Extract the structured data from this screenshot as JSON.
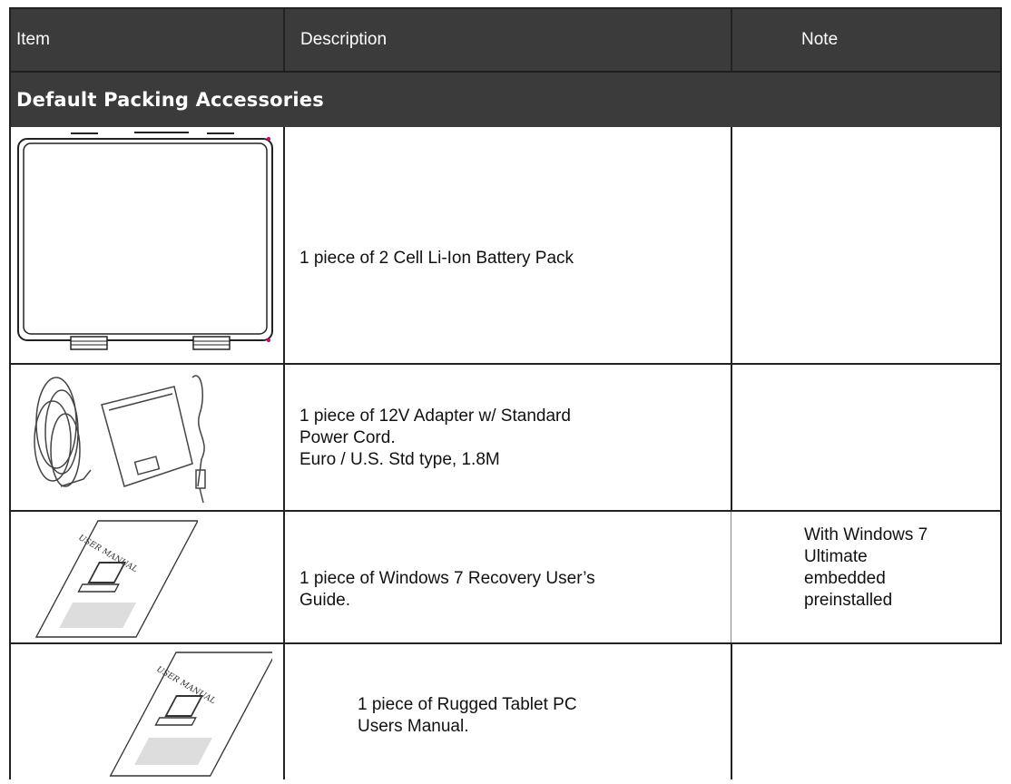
{
  "header": {
    "item": "Item",
    "description": "Description",
    "note": "Note"
  },
  "section": {
    "title": "Default Packing Accessories"
  },
  "rows": [
    {
      "description_lines": [
        "1 piece of 2 Cell Li-Ion Battery Pack"
      ],
      "note_lines": []
    },
    {
      "description_lines": [
        "1 piece of 12V Adapter w/ Standard",
        "Power Cord.",
        "Euro / U.S. Std type, 1.8M"
      ],
      "note_lines": []
    },
    {
      "description_lines": [
        "1 piece of Windows 7 Recovery User’s",
        "Guide."
      ],
      "note_lines": [
        "With Windows 7",
        "Ultimate",
        "embedded",
        "preinstalled"
      ]
    },
    {
      "description_lines": [
        "1 piece of Rugged Tablet PC",
        "Users Manual."
      ],
      "note_lines": []
    }
  ],
  "images": {
    "manual_cover_text": "USER MANUAL"
  }
}
